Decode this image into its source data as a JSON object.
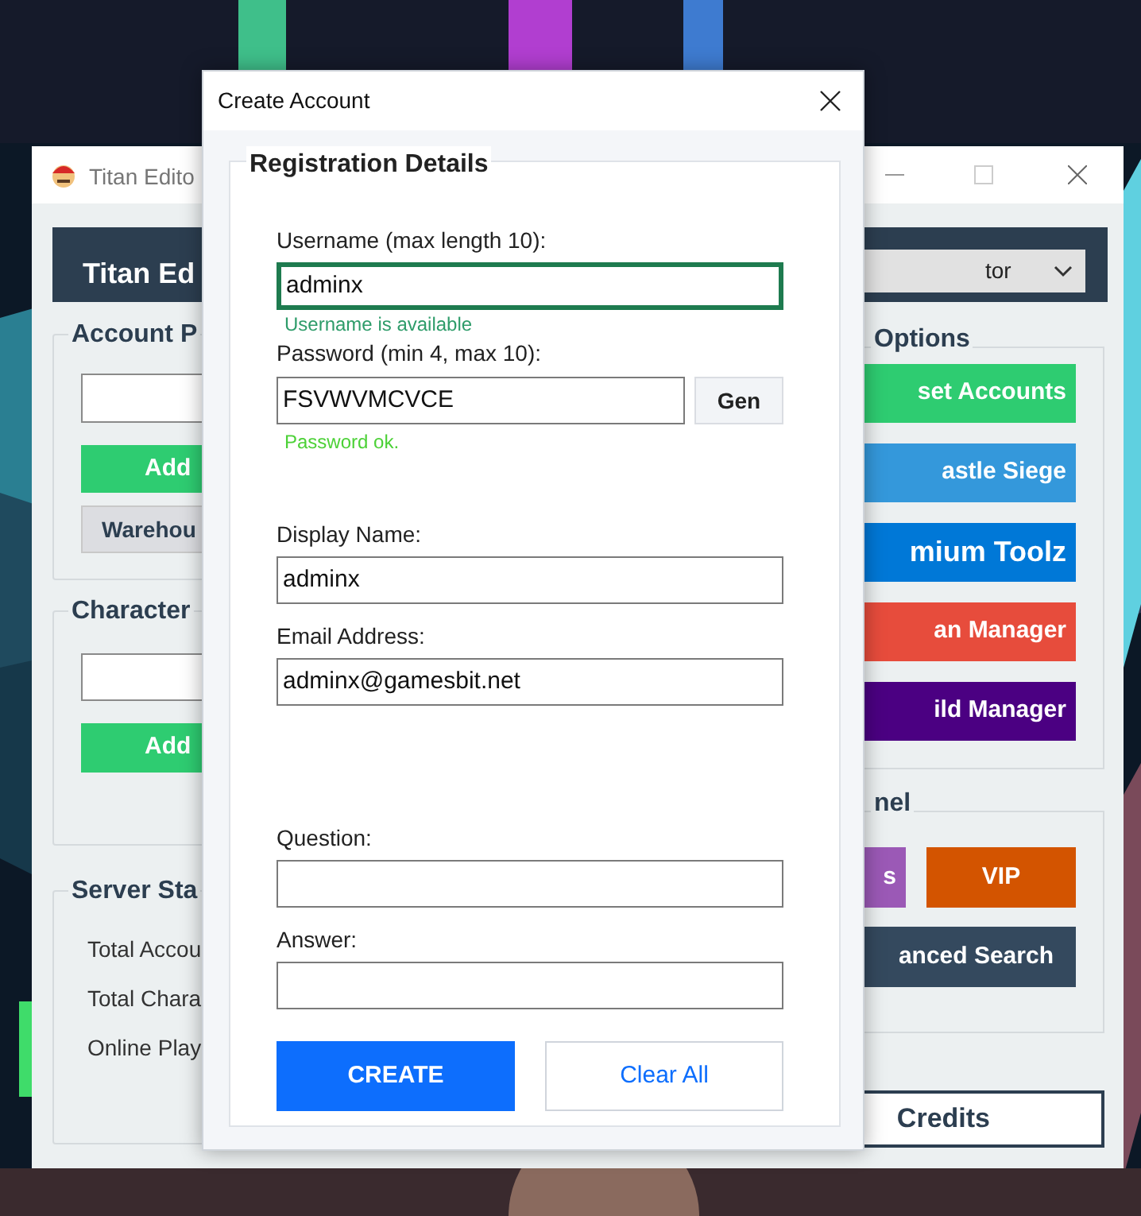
{
  "main_window": {
    "title": "Titan Edito",
    "header": "Titan Ed",
    "dropdown": "tor",
    "account_panel": {
      "title": "Account P",
      "add": "Add",
      "warehouse": "Warehou"
    },
    "character_panel": {
      "title": "Character",
      "add": "Add"
    },
    "server_stats": {
      "title": "Server Sta",
      "lines": [
        "Total Accou",
        "Total Chara",
        "Online Play"
      ]
    },
    "options": {
      "title": "Options",
      "buttons": [
        {
          "label": "set Accounts",
          "color": "#2ecc71"
        },
        {
          "label": "astle Siege",
          "color": "#3498db"
        },
        {
          "label": "mium Toolz",
          "color": "#0078d7"
        },
        {
          "label": "an Manager",
          "color": "#e74c3c"
        },
        {
          "label": "ild Manager",
          "color": "#4b0082"
        }
      ]
    },
    "panel": {
      "title": "nel",
      "buttons": [
        {
          "label": "s",
          "color": "#9b59b6"
        },
        {
          "label": "VIP",
          "color": "#d35400"
        },
        {
          "label": "anced Search",
          "color": "#34495e"
        }
      ]
    },
    "credits": "Credits"
  },
  "dialog": {
    "title": "Create Account",
    "group_title": "Registration Details",
    "username": {
      "label": "Username (max length 10):",
      "value": "adminx",
      "focused": true,
      "status": "Username is available"
    },
    "password": {
      "label": "Password (min 4, max 10):",
      "value": "FSVWVMCVCE",
      "generate": "Gen",
      "status": "Password ok."
    },
    "display_name": {
      "label": "Display Name:",
      "value": "adminx"
    },
    "email": {
      "label": "Email Address:",
      "value": "adminx@gamesbit.net"
    },
    "question": {
      "label": "Question:"
    },
    "answer": {
      "label": "Answer:"
    },
    "create": "CREATE",
    "clear": "Clear All"
  }
}
